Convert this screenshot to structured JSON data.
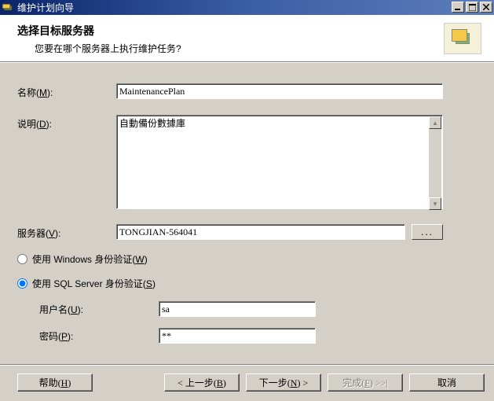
{
  "window": {
    "title": "维护计划向导"
  },
  "header": {
    "title": "选择目标服务器",
    "subtitle": "您要在哪个服务器上执行维护任务?"
  },
  "form": {
    "name_label": "名称(M):",
    "name_value": "MaintenancePlan",
    "desc_label": "说明(D):",
    "desc_value": "自動備份數據庫",
    "server_label": "服务器(V):",
    "server_value": "TONGJIAN-564041",
    "browse_label": "...",
    "radio_windows": "使用 Windows 身份验证(W)",
    "radio_sql": "使用 SQL Server 身份验证(S)",
    "user_label": "用户名(U):",
    "user_value": "sa",
    "pwd_label": "密码(P):",
    "pwd_value": "**"
  },
  "buttons": {
    "help": "帮助(H)",
    "back": "< 上一步(B)",
    "next": "下一步(N) >",
    "finish": "完成(F) >>|",
    "cancel": "取消"
  }
}
